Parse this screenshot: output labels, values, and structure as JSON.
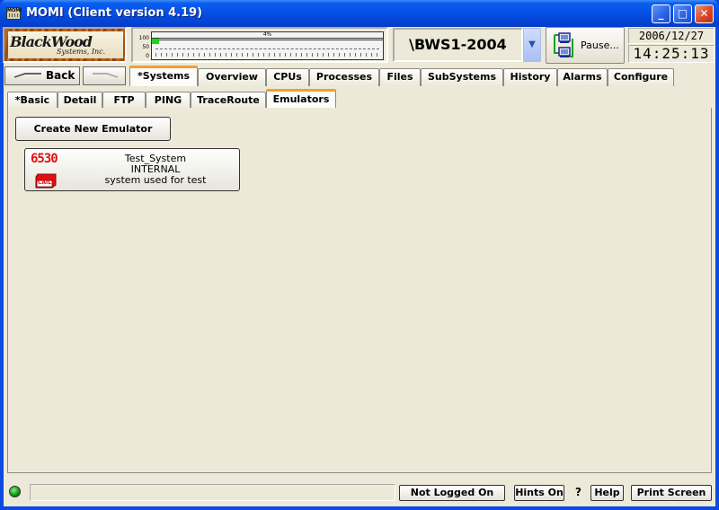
{
  "window": {
    "title": "MOMI (Client version 4.19)",
    "app_icon_text": "MOMI",
    "controls": {
      "minimize": "_",
      "maximize": "□",
      "close": "✕"
    }
  },
  "logo": {
    "title": "BlackWood",
    "subtitle": "Systems, Inc."
  },
  "gauge": {
    "scale_top": "100",
    "scale_mid": "50",
    "scale_bottom": "0",
    "percent_label": "4%",
    "level_percent": 4,
    "level_color": "#1fd21f"
  },
  "system": {
    "name": "\\BWS1-2004",
    "dropdown_icon": "chevron-down"
  },
  "pause": {
    "label": "Pause...",
    "icon": "computers-exchange-icon"
  },
  "clock": {
    "date": "2006/12/27",
    "time": "14:25:13"
  },
  "nav": {
    "back_label": "Back",
    "forward_label": ""
  },
  "main_tabs": [
    {
      "label": "*Systems",
      "selected": true
    },
    {
      "label": "Overview"
    },
    {
      "label": "CPUs"
    },
    {
      "label": "Processes"
    },
    {
      "label": "Files"
    },
    {
      "label": "SubSystems"
    },
    {
      "label": "History"
    },
    {
      "label": "Alarms"
    },
    {
      "label": "Configure"
    }
  ],
  "sub_tabs": [
    {
      "label": "*Basic"
    },
    {
      "label": "Detail"
    },
    {
      "label": "FTP"
    },
    {
      "label": "PING"
    },
    {
      "label": "TraceRoute"
    },
    {
      "label": "Emulators",
      "selected": true
    }
  ],
  "content": {
    "create_button_label": "Create New Emulator",
    "emulators": [
      {
        "model": "6530",
        "badge": "CAIL",
        "name": "Test_System",
        "type": "INTERNAL",
        "description": "system used for test"
      }
    ]
  },
  "statusbar": {
    "message": "",
    "login_status": "Not Logged On",
    "hints_label": "Hints On",
    "question": "?",
    "help_label": "Help",
    "print_label": "Print Screen",
    "led_color": "#109010"
  },
  "colors": {
    "accent_tab": "#f0a030",
    "titlebar": "#0551e6",
    "background": "#ECE9D8",
    "model_red": "#e01010"
  }
}
